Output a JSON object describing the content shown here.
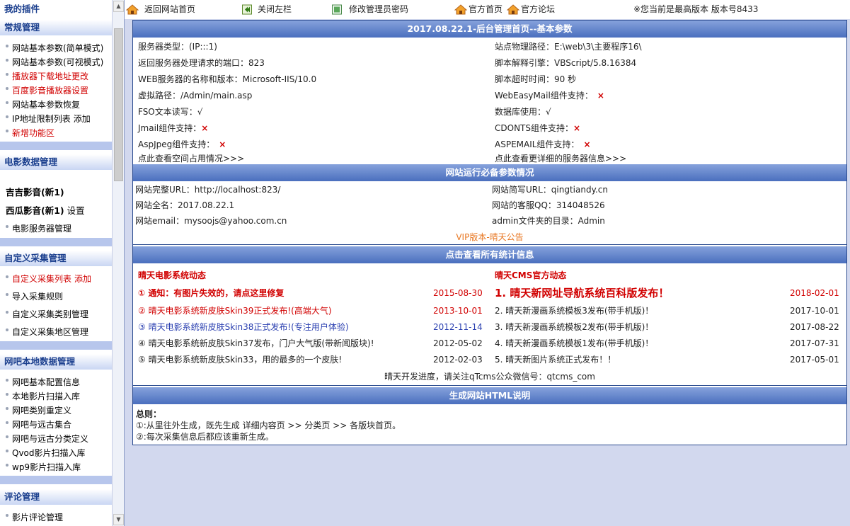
{
  "sidebar": {
    "my_plugins": "我的插件",
    "sections": {
      "regular": "常规管理",
      "movie_data": "电影数据管理",
      "custom_collect": "自定义采集管理",
      "netbar": "网吧本地数据管理",
      "comments": "评论管理"
    },
    "regular_items": [
      {
        "label": "网站基本参数(简单模式)",
        "extra": ""
      },
      {
        "label": "网站基本参数(可视模式)",
        "extra": ""
      },
      {
        "label": "播放器下载地址更改",
        "extra": ""
      },
      {
        "label": "百度影音播放器设置",
        "extra": ""
      },
      {
        "label": "网站基本参数恢复",
        "extra": ""
      },
      {
        "label": "IP地址限制列表",
        "extra": "添加"
      },
      {
        "label": "新增功能区",
        "extra": ""
      }
    ],
    "movie_items": [
      {
        "label": "吉吉影音(新1)",
        "extra": ""
      },
      {
        "label": "西瓜影音(新1)",
        "extra": "设置"
      },
      {
        "label": "电影服务器管理",
        "extra": ""
      }
    ],
    "collect_items": [
      {
        "label": "自定义采集列表",
        "extra": "添加"
      },
      {
        "label": "导入采集规则",
        "extra": ""
      },
      {
        "label": "自定义采集类别管理",
        "extra": ""
      },
      {
        "label": "自定义采集地区管理",
        "extra": ""
      }
    ],
    "netbar_items": [
      {
        "label": "网吧基本配置信息",
        "extra": ""
      },
      {
        "label": "本地影片扫描入库",
        "extra": ""
      },
      {
        "label": "网吧类别重定义",
        "extra": ""
      },
      {
        "label": "网吧与远古集合",
        "extra": ""
      },
      {
        "label": "网吧与远古分类定义",
        "extra": ""
      },
      {
        "label": "Qvod影片扫描入库",
        "extra": ""
      },
      {
        "label": "wp9影片扫描入库",
        "extra": ""
      }
    ],
    "comment_items": [
      {
        "label": "影片评论管理",
        "extra": ""
      }
    ]
  },
  "topbar": {
    "home": "返回网站首页",
    "close_left": "关闭左栏",
    "change_password": "修改管理员密码",
    "official_home": "官方首页",
    "official_forum": "官方论坛",
    "version": "※您当前是最高版本 版本号8433"
  },
  "server": {
    "title": "2017.08.22.1-后台管理首页--基本参数",
    "server_type": "服务器类型：(IP:::1)",
    "physical_path": "站点物理路径：E:\\web\\3\\主要程序16\\",
    "port": "返回服务器处理请求的端口：823",
    "script_engine": "脚本解释引擎：VBScript/5.8.16384",
    "web_server": "WEB服务器的名称和版本：Microsoft-IIS/10.0",
    "timeout": "脚本超时时间：90 秒",
    "virtual_path": "虚拟路径：/Admin/main.asp",
    "webeasymail": "WebEasyMail组件支持：",
    "fso": "FSO文本读写：√",
    "database": "数据库使用：√",
    "jmail": "Jmail组件支持：",
    "cdonts": "CDONTS组件支持：",
    "aspjpeg": "AspJpeg组件支持：",
    "aspemail": "ASPEMAIL组件支持：",
    "space_link": "点此查看空间占用情况>>>",
    "detail_link": "点此查看更详细的服务器信息>>>",
    "unsupported_mark": "×"
  },
  "site": {
    "title": "网站运行必备参数情况",
    "url": "网站完整URL：http://localhost:823/",
    "short_url": "网站简写URL：qingtiandy.cn",
    "full_name": "网站全名：2017.08.22.1",
    "qq": "网站的客服QQ：314048526",
    "email": "网站email：mysoojs@yahoo.com.cn",
    "admin_dir": "admin文件夹的目录：Admin",
    "vip": "VIP版本-晴天公告"
  },
  "stats": {
    "title": "点击查看所有统计信息",
    "left_title": "晴天电影系统动态",
    "right_title": "晴天CMS官方动态",
    "left_news": [
      {
        "text": "① 通知：有图片失效的，请点这里修复",
        "date": "2015-08-30"
      },
      {
        "text": "② 晴天电影系统新皮肤Skin39正式发布!(高端大气)",
        "date": "2013-10-01"
      },
      {
        "text": "③ 晴天电影系统新皮肤Skin38正式发布!(专注用户体验)",
        "date": "2012-11-14"
      },
      {
        "text": "④ 晴天电影系统新皮肤Skin37发布，门户大气版(带新闻版块)!",
        "date": "2012-05-02"
      },
      {
        "text": "⑤ 晴天电影系统新皮肤Skin33，用的最多的一个皮肤!",
        "date": "2012-02-03"
      }
    ],
    "right_news": [
      {
        "text": "1. 晴天新网址导航系统百科版发布！",
        "date": "2018-02-01"
      },
      {
        "text": "2. 晴天新漫画系统模板3发布(带手机版)！",
        "date": "2017-10-01"
      },
      {
        "text": "3. 晴天新漫画系统模板2发布(带手机版)！",
        "date": "2017-08-22"
      },
      {
        "text": "4. 晴天新漫画系统模板1发布(带手机版)！",
        "date": "2017-07-31"
      },
      {
        "text": "5. 晴天新图片系统正式发布！！",
        "date": "2017-05-01"
      }
    ],
    "follow": "晴天开发进度，请关注qTcms公众微信号：qtcms_com"
  },
  "html_gen": {
    "title": "生成网站HTML说明",
    "general": "总则：",
    "line1": "①:从里往外生成，既先生成 详细内容页 >> 分类页 >> 各版块首页。",
    "line2": "②:每次采集信息后都应该重新生成。"
  },
  "colors": {
    "header_blue": "#4a6fbe",
    "sidebar_title": "#1b3f8e",
    "red": "#d10000",
    "orange": "#e87722",
    "blue_link": "#2a3fb0"
  }
}
